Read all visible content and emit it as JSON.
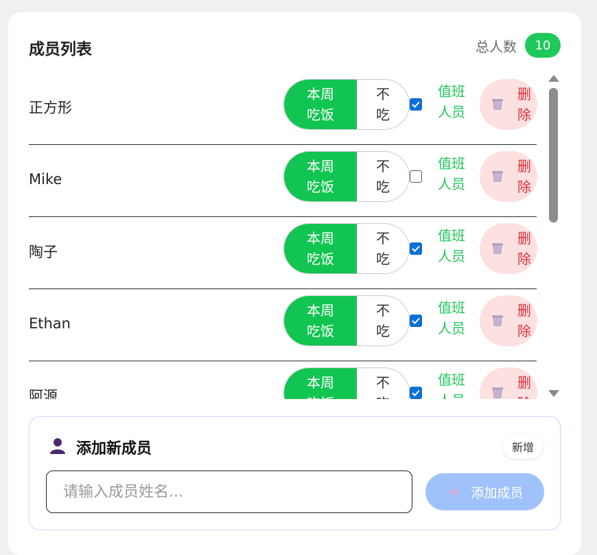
{
  "header": {
    "title": "成员列表",
    "total_label": "总人数",
    "total_count": "10"
  },
  "members": [
    {
      "name": "正方形",
      "toggle_on": "本周吃饭",
      "toggle_off": "不吃",
      "duty_checked": true,
      "duty_label": "值班人员",
      "delete_label": "删除"
    },
    {
      "name": "Mike",
      "toggle_on": "本周吃饭",
      "toggle_off": "不吃",
      "duty_checked": false,
      "duty_label": "值班人员",
      "delete_label": "删除"
    },
    {
      "name": "陶子",
      "toggle_on": "本周吃饭",
      "toggle_off": "不吃",
      "duty_checked": true,
      "duty_label": "值班人员",
      "delete_label": "删除"
    },
    {
      "name": "Ethan",
      "toggle_on": "本周吃饭",
      "toggle_off": "不吃",
      "duty_checked": true,
      "duty_label": "值班人员",
      "delete_label": "删除"
    },
    {
      "name": "阿源",
      "toggle_on": "本周吃饭",
      "toggle_off": "不吃",
      "duty_checked": true,
      "duty_label": "值班人员",
      "delete_label": "删除"
    }
  ],
  "add_panel": {
    "title": "添加新成员",
    "tag": "新增",
    "input_value": "",
    "input_placeholder": "请输入成员姓名...",
    "button_label": "添加成员"
  },
  "colors": {
    "accent_green": "#1ec85a",
    "toggle_green": "#12c452",
    "delete_red": "#e0303a",
    "delete_bg": "#fde0e0",
    "add_button_bg": "#9fc2fb",
    "checkbox_blue": "#0b6fd6"
  },
  "icons": {
    "delete": "trash-icon",
    "add_title": "user-icon",
    "add_button": "plus-icon"
  }
}
